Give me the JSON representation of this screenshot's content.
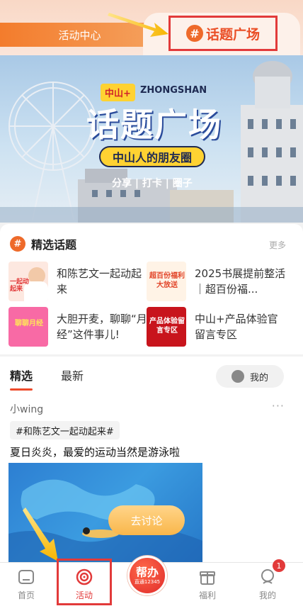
{
  "header": {
    "tab_left_label": "活动中心",
    "tab_right_label": "话题广场",
    "hash_symbol": "#"
  },
  "banner": {
    "tag": "中山+",
    "english": "ZHONGSHAN",
    "title": "话题广场",
    "subtitle": "中山人的朋友圈",
    "tags_line": "分享 | 打卡 | 圈子"
  },
  "featured_topics": {
    "title": "精选话题",
    "more_label": "更多",
    "icon_symbol": "#",
    "items": [
      {
        "label": "和陈艺文一起动起来",
        "thumb_text": "一起动起来"
      },
      {
        "label": "2025书展提前整活｜超百份福...",
        "thumb_text": "超百份福利大放送"
      },
      {
        "label": "大胆开麦，聊聊“月经”这件事儿!",
        "thumb_text": "聊聊月经"
      },
      {
        "label": "中山+产品体验官留言专区",
        "thumb_text": "产品体验留言专区"
      }
    ]
  },
  "feed": {
    "tabs": [
      "精选",
      "最新"
    ],
    "active_tab": "精选",
    "mine_label": "我的",
    "post": {
      "user": "小wing",
      "more": "···",
      "tag": "#和陈艺文一起动起来#",
      "title": "夏日炎炎，最爱的运动当然是游泳啦"
    },
    "discuss_label": "去讨论"
  },
  "nav": {
    "items": [
      {
        "label": "首页",
        "icon": "home-icon"
      },
      {
        "label": "活动",
        "icon": "target-icon"
      },
      {
        "label": "福利",
        "icon": "gift-icon"
      },
      {
        "label": "我的",
        "icon": "profile-icon"
      }
    ],
    "help_main": "帮办",
    "help_sub": "直通12345",
    "badge_count": "1"
  },
  "colors": {
    "accent": "#ee6a2a",
    "highlight": "#e23a3a",
    "active_nav": "#e23a3a"
  }
}
